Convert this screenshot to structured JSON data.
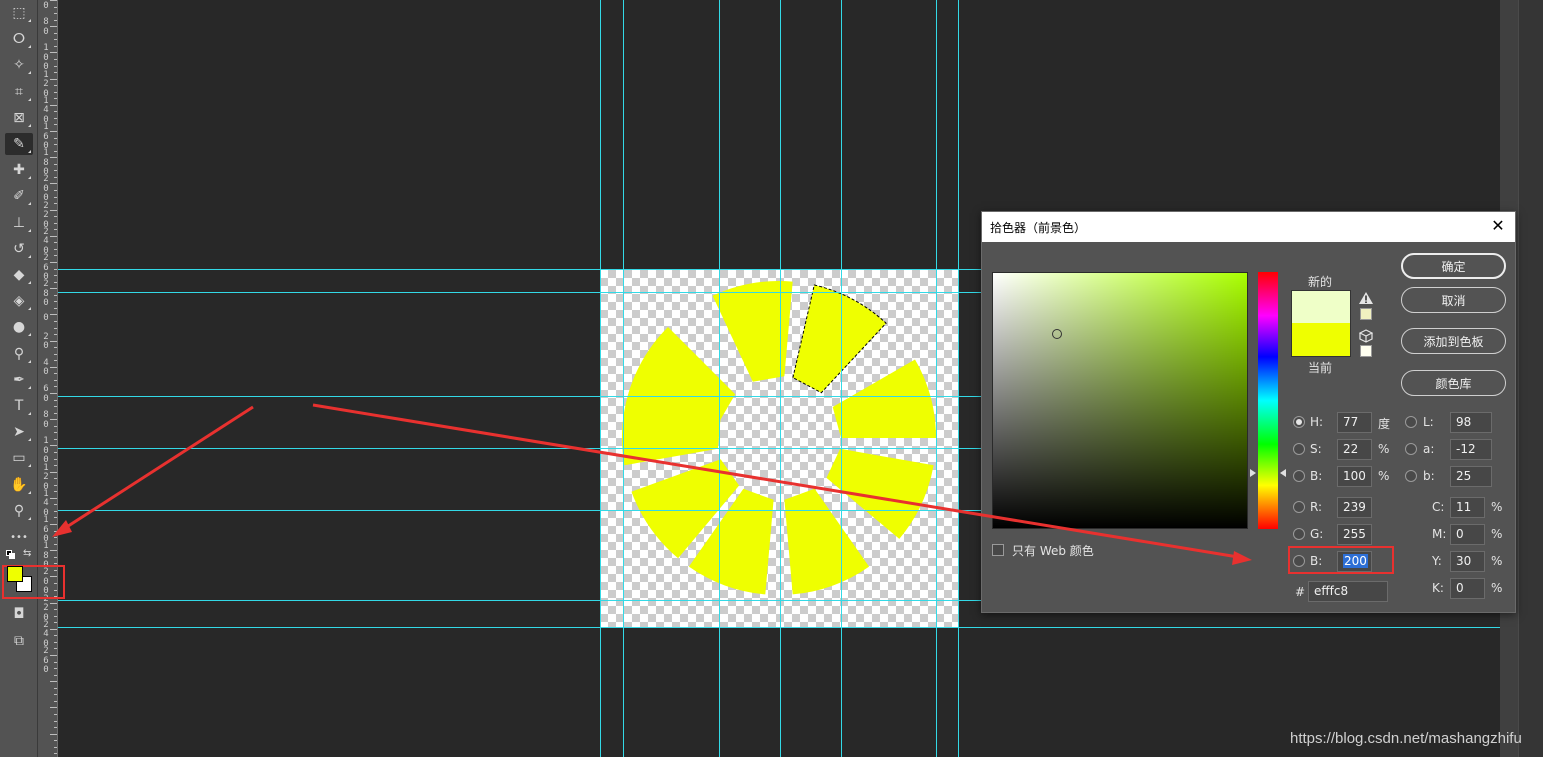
{
  "toolbar": {
    "tools": [
      {
        "name": "rect-marquee-icon",
        "glyph": "⬚"
      },
      {
        "name": "lasso-icon",
        "glyph": "ⵔ"
      },
      {
        "name": "magic-wand-icon",
        "glyph": "✧"
      },
      {
        "name": "crop-icon",
        "glyph": "⌗"
      },
      {
        "name": "frame-icon",
        "glyph": "⊠"
      },
      {
        "name": "eyedropper-icon",
        "glyph": "✎"
      },
      {
        "name": "healing-brush-icon",
        "glyph": "✚"
      },
      {
        "name": "brush-icon",
        "glyph": "✐"
      },
      {
        "name": "clone-stamp-icon",
        "glyph": "⊥"
      },
      {
        "name": "history-brush-icon",
        "glyph": "↺"
      },
      {
        "name": "eraser-icon",
        "glyph": "◆"
      },
      {
        "name": "paint-bucket-icon",
        "glyph": "◈"
      },
      {
        "name": "blur-icon",
        "glyph": "●"
      },
      {
        "name": "dodge-icon",
        "glyph": "⚲"
      },
      {
        "name": "pen-icon",
        "glyph": "✒"
      },
      {
        "name": "type-icon",
        "glyph": "T"
      },
      {
        "name": "path-select-icon",
        "glyph": "➤"
      },
      {
        "name": "rectangle-icon",
        "glyph": "▭"
      },
      {
        "name": "hand-icon",
        "glyph": "✋"
      },
      {
        "name": "zoom-icon",
        "glyph": "⚲"
      },
      {
        "name": "more-tools-icon",
        "glyph": "•••"
      }
    ],
    "bottom_tools": [
      {
        "name": "quick-mask-icon",
        "glyph": "◘"
      },
      {
        "name": "screen-mode-icon",
        "glyph": "⧉"
      }
    ],
    "foreground_color": "#efff00",
    "background_color": "#ffffff"
  },
  "ruler": {
    "labels": [
      "6\n0",
      "8\n0",
      "1\n0\n0",
      "1\n2\n0",
      "1\n4\n0",
      "1\n6\n0",
      "1\n8\n0",
      "2\n0\n0",
      "2\n2\n0",
      "2\n4\n0",
      "2\n6\n0",
      "2\n8\n0",
      "0",
      "2\n0",
      "4\n0",
      "6\n0",
      "8\n0",
      "1\n0\n0",
      "1\n2\n0",
      "1\n4\n0",
      "1\n6\n0",
      "1\n8\n0",
      "2\n0\n0",
      "2\n2\n0",
      "2\n4\n0",
      "2\n6\n0"
    ]
  },
  "canvas": {
    "slice_color": "#efff00",
    "guide_color": "#33d9e6"
  },
  "color_picker": {
    "title": "拾色器（前景色）",
    "close_glyph": "✕",
    "new_label": "新的",
    "current_label": "当前",
    "new_color": "#efffc8",
    "current_color": "#efff00",
    "buttons": {
      "ok": "确定",
      "cancel": "取消",
      "add_to_swatches": "添加到色板",
      "color_libraries": "颜色库"
    },
    "hsb": {
      "h_label": "H:",
      "h_value": "77",
      "h_unit": "度",
      "s_label": "S:",
      "s_value": "22",
      "s_unit": "%",
      "b_label": "B:",
      "b_value": "100",
      "b_unit": "%"
    },
    "lab": {
      "l_label": "L:",
      "l_value": "98",
      "a_label": "a:",
      "a_value": "-12",
      "b_label": "b:",
      "b_value": "25"
    },
    "rgb": {
      "r_label": "R:",
      "r_value": "239",
      "g_label": "G:",
      "g_value": "255",
      "b_label": "B:",
      "b_value": "200"
    },
    "cmyk": {
      "c_label": "C:",
      "c_value": "11",
      "m_label": "M:",
      "m_value": "0",
      "y_label": "Y:",
      "y_value": "30",
      "k_label": "K:",
      "k_value": "0",
      "unit": "%"
    },
    "hex_label": "#",
    "hex_value": "efffc8",
    "web_only_label": "只有 Web 颜色"
  },
  "annotation_color": "#e8312f",
  "watermark": "https://blog.csdn.net/mashangzhifu"
}
